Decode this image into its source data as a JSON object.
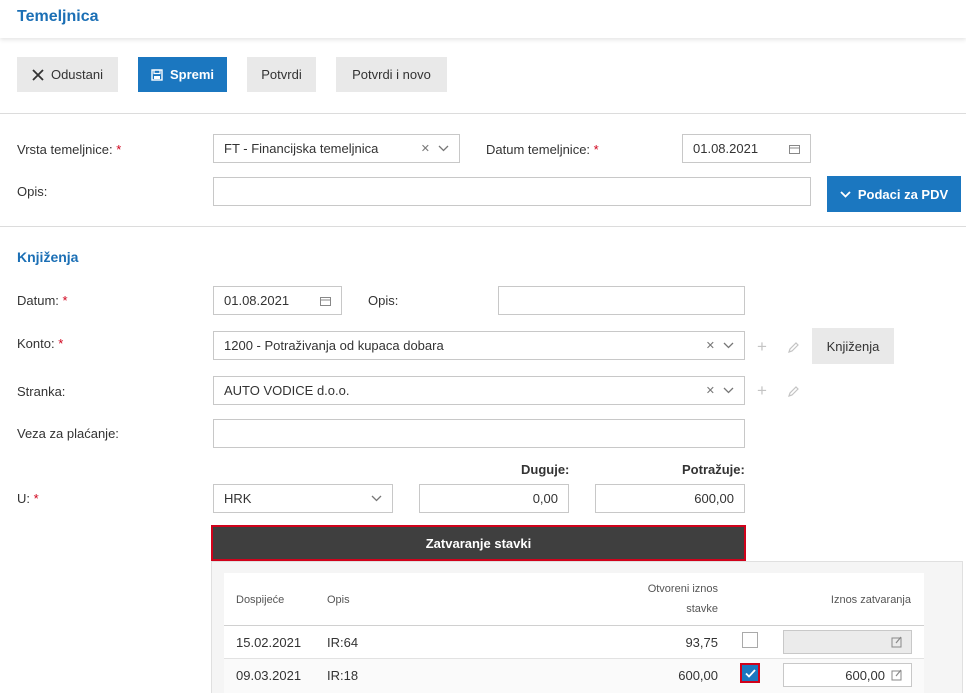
{
  "header": {
    "title": "Temeljnica"
  },
  "toolbar": {
    "cancel_label": "Odustani",
    "save_label": "Spremi",
    "confirm_label": "Potvrdi",
    "confirm_new_label": "Potvrdi i novo"
  },
  "form": {
    "type_label": "Vrsta temeljnice:",
    "type_value": "FT - Financijska temeljnica",
    "date_label": "Datum temeljnice:",
    "date_value": "01.08.2021",
    "desc_label": "Opis:",
    "desc_value": "",
    "vat_button": "Podaci za PDV"
  },
  "postings": {
    "title": "Knjiženja",
    "date_label": "Datum:",
    "date_value": "01.08.2021",
    "desc_label": "Opis:",
    "desc_value": "",
    "account_label": "Konto:",
    "account_value": "1200 - Potraživanja od kupaca dobara",
    "postings_button": "Knjiženja",
    "partner_label": "Stranka:",
    "partner_value": "AUTO VODICE d.o.o.",
    "payment_ref_label": "Veza za plaćanje:",
    "payment_ref_value": "",
    "debit_label": "Duguje:",
    "credit_label": "Potražuje:",
    "currency_label": "U:",
    "currency_value": "HRK",
    "debit_value": "0,00",
    "credit_value": "600,00"
  },
  "closing": {
    "bar_label": "Zatvaranje stavki",
    "columns": {
      "due": "Dospijeće",
      "desc": "Opis",
      "open_amount_1": "Otvoreni iznos",
      "open_amount_2": "stavke",
      "closing_amount": "Iznos zatvaranja"
    },
    "rows": [
      {
        "due": "15.02.2021",
        "desc": "IR:64",
        "open": "93,75",
        "checked": false,
        "closing": ""
      },
      {
        "due": "09.03.2021",
        "desc": "IR:18",
        "open": "600,00",
        "checked": true,
        "closing": "600,00"
      }
    ]
  },
  "colors": {
    "accent": "#1b77c0",
    "title": "#1b6fb5",
    "highlight": "#d0021b",
    "dark_bar": "#3f3f3f"
  }
}
